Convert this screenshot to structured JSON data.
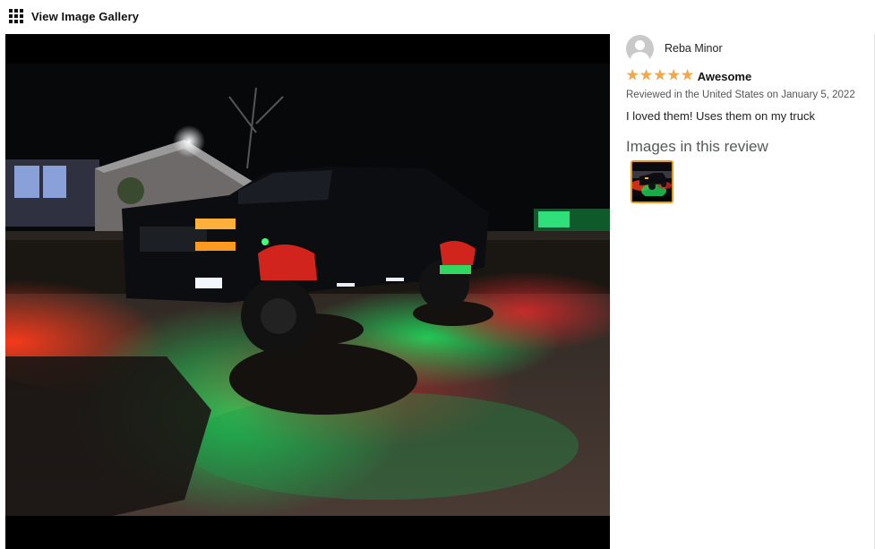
{
  "gallery": {
    "link_label": "View Image Gallery",
    "icon": "grid-icon"
  },
  "image": {
    "alt": "Truck with red and green underglow lights at night"
  },
  "review": {
    "reviewer_name": "Reba Minor",
    "avatar_icon": "user-avatar-icon",
    "rating": 5,
    "rating_max": 5,
    "title": "Awesome",
    "date_text": "Reviewed in the United States on January 5, 2022",
    "body": "I loved them! Uses them on my truck",
    "images_heading": "Images in this review"
  },
  "colors": {
    "star": "#f3a847",
    "thumb_border": "#e59a1a",
    "heading": "#565959"
  }
}
